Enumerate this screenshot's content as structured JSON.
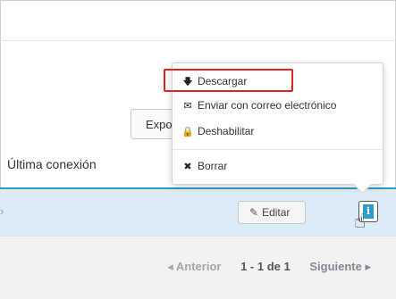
{
  "toolbar": {
    "export_label": "Exportar"
  },
  "table": {
    "column_header": "Última conexión",
    "row": {
      "edit_label": "Editar",
      "info_icon": "i"
    }
  },
  "pager": {
    "prev_label": "◂ Anterior",
    "range_label": "1 - 1 de 1",
    "next_label": "Siguiente ▸"
  },
  "menu": {
    "items": [
      {
        "icon": "download-icon",
        "glyph": "🡇",
        "label": "Descargar"
      },
      {
        "icon": "envelope-icon",
        "glyph": "✉",
        "label": "Enviar con correo electrónico"
      },
      {
        "icon": "lock-icon",
        "glyph": "🔒",
        "label": "Deshabilitar"
      },
      {
        "icon": "close-icon",
        "glyph": "✖",
        "label": "Borrar"
      }
    ]
  },
  "colors": {
    "accent": "#2e9cca",
    "row_highlight": "#dcecf6",
    "annotation_red": "#e52222"
  }
}
